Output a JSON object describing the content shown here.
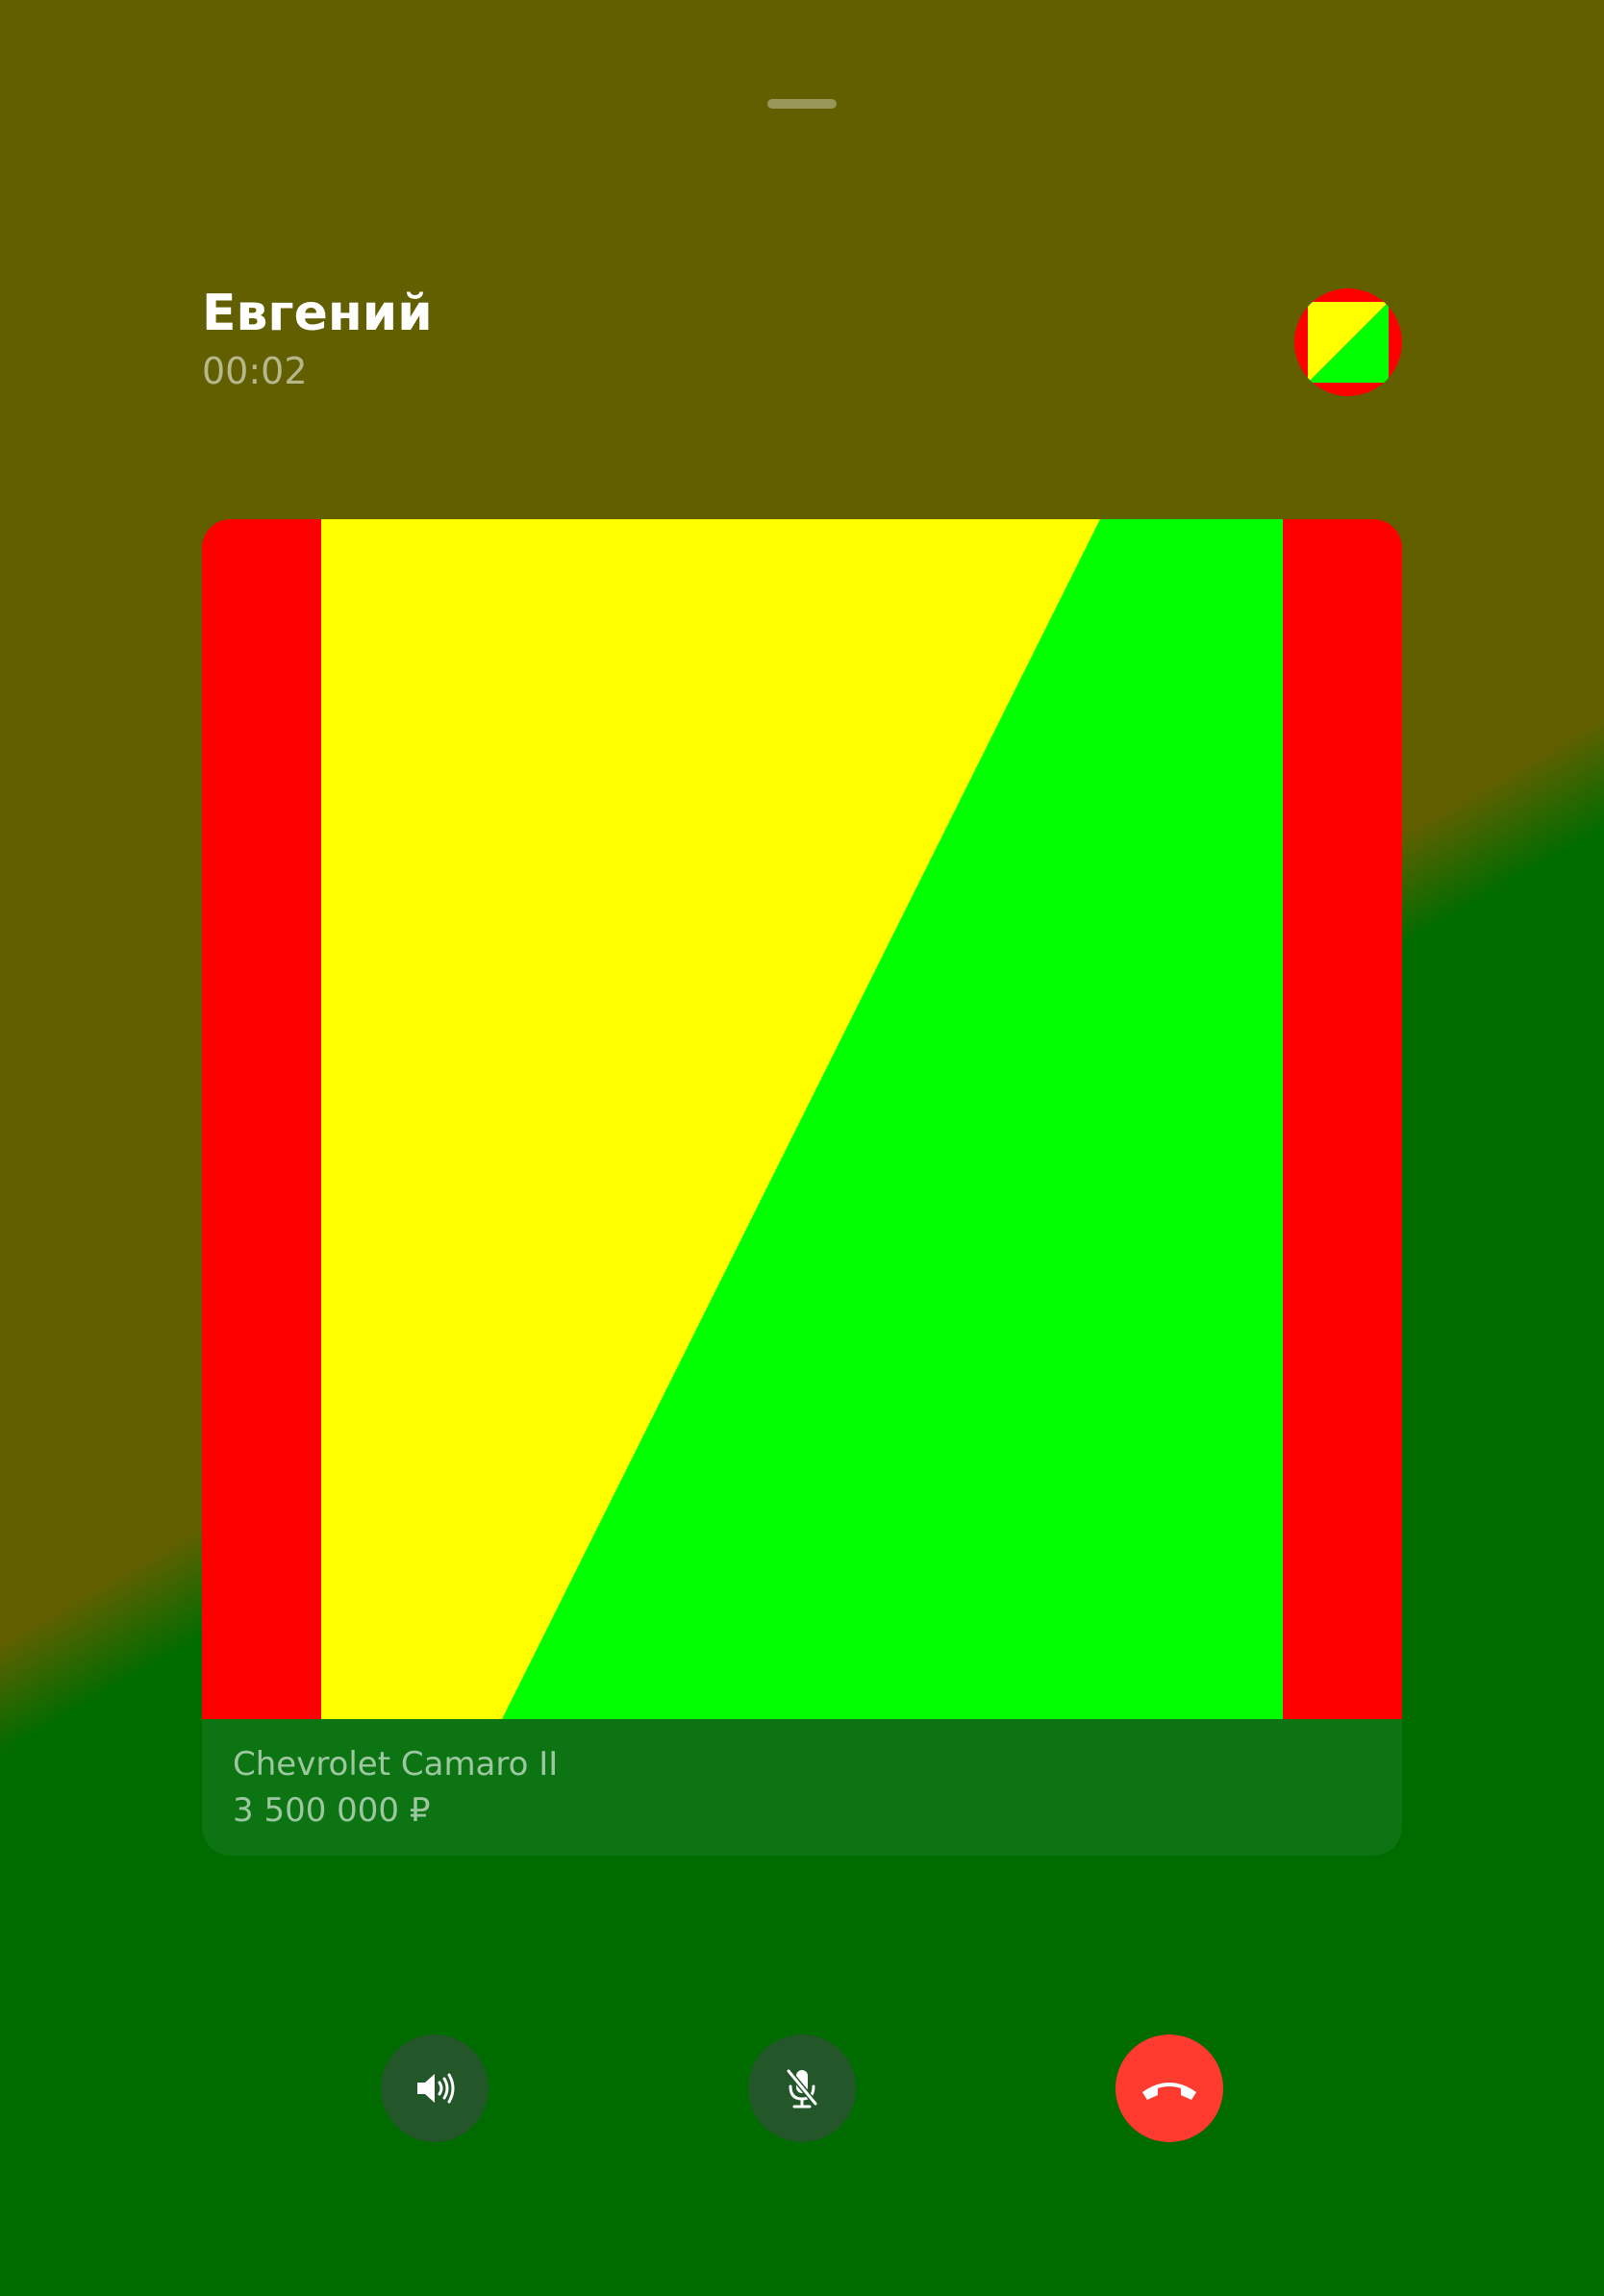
{
  "call": {
    "caller_name": "Евгений",
    "timer": "00:02"
  },
  "listing": {
    "title": "Chevrolet Camaro II",
    "price": "3 500 000 ₽"
  },
  "controls": [
    {
      "name": "speaker-button",
      "icon": "speaker-icon"
    },
    {
      "name": "mute-button",
      "icon": "microphone-off-icon"
    },
    {
      "name": "hang-up-button",
      "icon": "phone-hangup-icon"
    }
  ],
  "colors": {
    "background_top": "#615f00",
    "background_bottom": "#006c00",
    "image_red": "#ff0000",
    "image_yellow": "#ffff00",
    "image_green": "#00ff00",
    "info_bar": "#0c7412",
    "control_button": "#23572a",
    "hangup_button": "#ff3b30"
  }
}
